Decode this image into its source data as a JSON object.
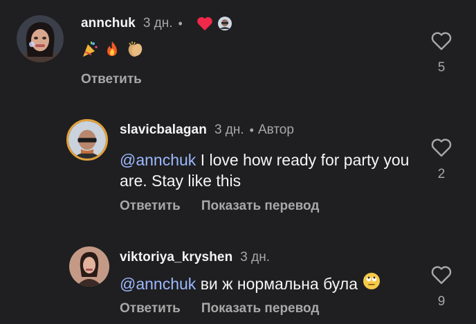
{
  "comments": [
    {
      "username": "annchuk",
      "time": "3 дн.",
      "dot": "•",
      "text": "🎉🔥👏",
      "reply_label": "Ответить",
      "likes": "5",
      "icons": [
        "heart-icon",
        "mini-avatar-icon"
      ],
      "colors": {
        "heart": "#f02849"
      }
    },
    {
      "username": "slavicbalagan",
      "time": "3 дн.",
      "dot": "•",
      "author_label": "Автор",
      "mention": "@annchuk",
      "text": " I love how ready for party you are. Stay like this",
      "reply_label": "Ответить",
      "translate_label": "Показать перевод",
      "likes": "2"
    },
    {
      "username": "viktoriya_kryshen",
      "time": "3 дн.",
      "mention": "@annchuk",
      "text": " ви ж нормальна була",
      "trailing_emoji": "rolling-eyes-emoji",
      "reply_label": "Ответить",
      "translate_label": "Показать перевод",
      "likes": "9"
    }
  ],
  "colors": {
    "background": "#1f1f21",
    "primary_text": "#f5f5f5",
    "secondary_text": "#a8a8a8",
    "mention": "#9db9ff"
  }
}
